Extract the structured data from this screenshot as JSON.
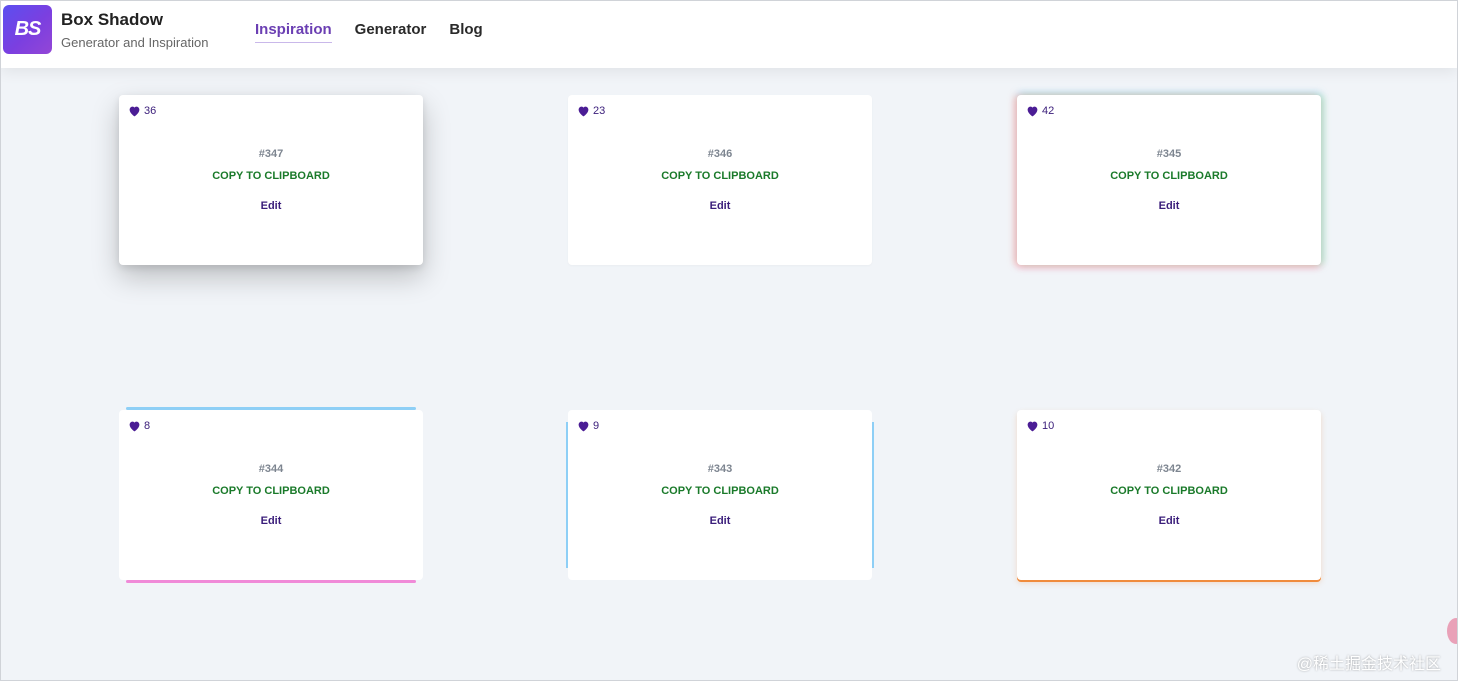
{
  "header": {
    "logo_text": "BS",
    "title": "Box Shadow",
    "subtitle": "Generator and Inspiration",
    "nav": [
      {
        "label": "Inspiration",
        "active": true
      },
      {
        "label": "Generator",
        "active": false
      },
      {
        "label": "Blog",
        "active": false
      }
    ]
  },
  "cards": [
    {
      "likes": "36",
      "id": "#347",
      "copy_label": "COPY TO CLIPBOARD",
      "edit_label": "Edit"
    },
    {
      "likes": "23",
      "id": "#346",
      "copy_label": "COPY TO CLIPBOARD",
      "edit_label": "Edit"
    },
    {
      "likes": "42",
      "id": "#345",
      "copy_label": "COPY TO CLIPBOARD",
      "edit_label": "Edit"
    },
    {
      "likes": "8",
      "id": "#344",
      "copy_label": "COPY TO CLIPBOARD",
      "edit_label": "Edit"
    },
    {
      "likes": "9",
      "id": "#343",
      "copy_label": "COPY TO CLIPBOARD",
      "edit_label": "Edit"
    },
    {
      "likes": "10",
      "id": "#342",
      "copy_label": "COPY TO CLIPBOARD",
      "edit_label": "Edit"
    }
  ],
  "watermark": "@稀土掘金技术社区",
  "colors": {
    "accent": "#6b3fb3",
    "heart": "#4b1d95",
    "copy_text": "#1a7a2a",
    "background": "#f1f4f8"
  },
  "icons": {
    "like": "heart-icon",
    "logo": "logo-badge"
  }
}
